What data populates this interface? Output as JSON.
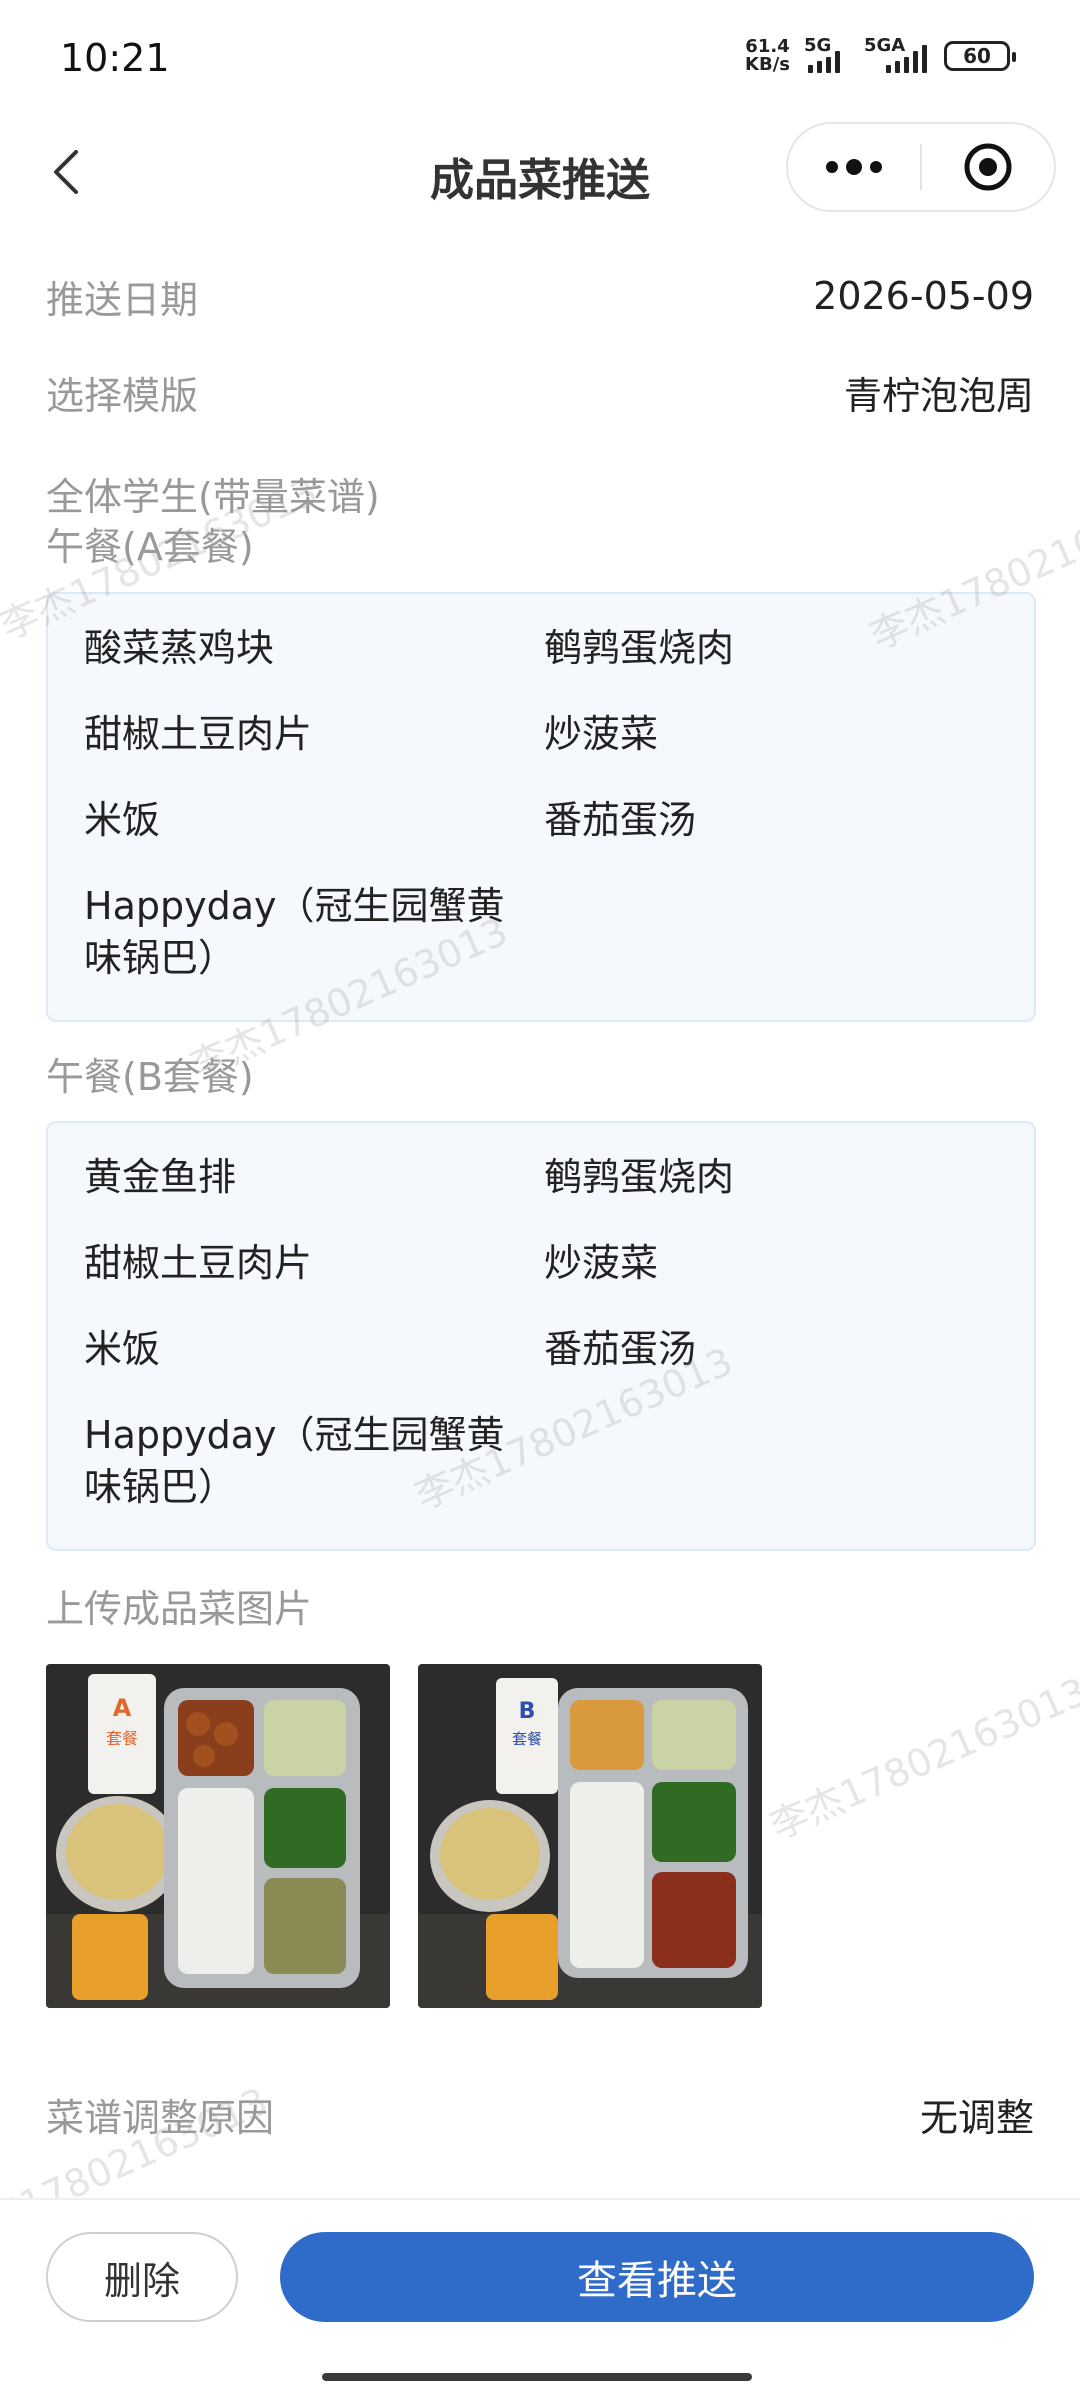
{
  "status_bar": {
    "time": "10:21",
    "net_speed_value": "61.4",
    "net_speed_unit": "KB/s",
    "sim1_label": "5G",
    "sim2_label": "5GA",
    "battery": "60"
  },
  "nav": {
    "title": "成品菜推送",
    "back_icon": "chevron-left-icon",
    "more_icon": "more-dots-icon",
    "target_icon": "target-icon"
  },
  "form": {
    "push_date_label": "推送日期",
    "push_date_value": "2026-05-09",
    "template_label": "选择模版",
    "template_value": "青柠泡泡周",
    "group_label": "全体学生(带量菜谱)"
  },
  "lunch_a": {
    "title": "午餐(A套餐)",
    "items": [
      "酸菜蒸鸡块",
      "鹌鹑蛋烧肉",
      "甜椒土豆肉片",
      "炒菠菜",
      "米饭",
      "番茄蛋汤",
      "Happyday（冠生园蟹黄",
      "味锅巴）"
    ]
  },
  "lunch_b": {
    "title": "午餐(B套餐)",
    "items": [
      "黄金鱼排",
      "鹌鹑蛋烧肉",
      "甜椒土豆肉片",
      "炒菠菜",
      "米饭",
      "番茄蛋汤",
      "Happyday（冠生园蟹黄",
      "味锅巴）"
    ]
  },
  "photos": {
    "label": "上传成品菜图片",
    "a_card_letter": "A",
    "a_card_text": "套餐",
    "b_card_letter": "B",
    "b_card_text": "套餐"
  },
  "adjust": {
    "label": "菜谱调整原因",
    "value": "无调整"
  },
  "actions": {
    "delete": "删除",
    "view_push": "查看推送"
  },
  "watermark": "李杰17802163013",
  "colors": {
    "primary": "#2f6cc9",
    "card_bg": "#f5f9fd",
    "card_border": "#dce9f6",
    "label": "#999999"
  }
}
